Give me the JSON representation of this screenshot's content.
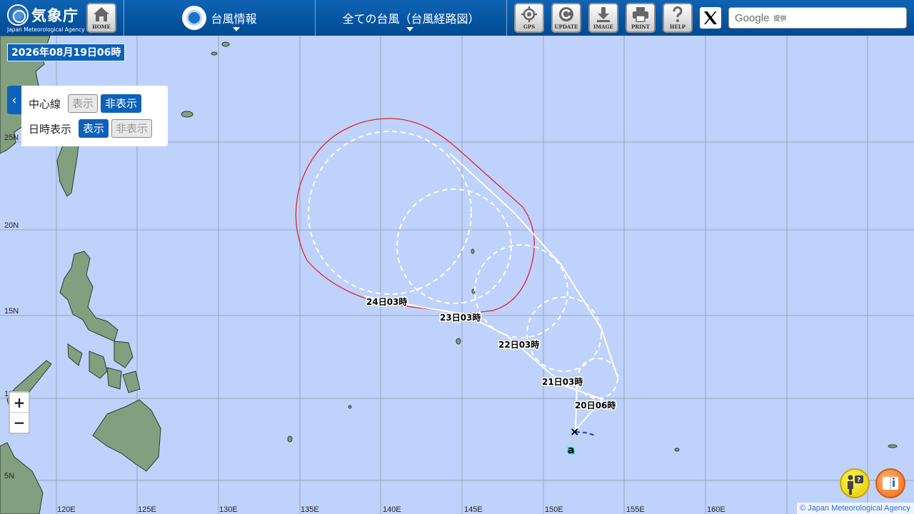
{
  "header": {
    "logo_text": "気象庁",
    "logo_subtext": "Japan Meteorological Agency",
    "home_label": "HOME",
    "menu_typhoon_label": "台風情報",
    "menu_all_label": "全ての台風（台風経路図）",
    "buttons": {
      "gps": "GPS",
      "update": "UPDATE",
      "image": "IMAGE",
      "print": "PRINT",
      "help": "HELP"
    },
    "search_brand": "Google",
    "search_suffix": "提供"
  },
  "map": {
    "datetime": "2026年08月19日06時",
    "lat_labels": [
      "25N",
      "20N",
      "15N",
      "10N",
      "5N"
    ],
    "lon_labels": [
      "120E",
      "125E",
      "130E",
      "135E",
      "140E",
      "145E",
      "150E",
      "155E",
      "160E"
    ],
    "land_color": "#82a07f",
    "sea_color": "#bfd2fb",
    "storm_marker": "×",
    "storm_label": "a",
    "forecast_times": [
      "20日06時",
      "21日03時",
      "22日03時",
      "23日03時",
      "24日03時"
    ]
  },
  "panel": {
    "row1_label": "中心線",
    "row1_show": "表示",
    "row1_hide": "非表示",
    "row2_label": "日時表示",
    "row2_show": "表示",
    "row2_hide": "非表示"
  },
  "zoom": {
    "in": "+",
    "out": "−"
  },
  "credit": "© Japan Meteorological Agency"
}
